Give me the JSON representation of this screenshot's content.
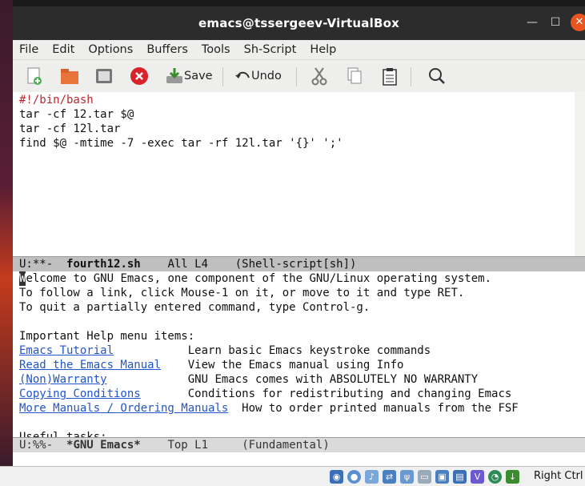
{
  "window": {
    "title": "emacs@tssergeev-VirtualBox"
  },
  "menu": [
    "File",
    "Edit",
    "Options",
    "Buffers",
    "Tools",
    "Sh-Script",
    "Help"
  ],
  "toolbar": {
    "save_label": "Save",
    "undo_label": "Undo"
  },
  "editor": {
    "lines": [
      "#!/bin/bash",
      "tar -cf 12.tar $@",
      "tar -cf 12l.tar",
      "find $@ -mtime -7 -exec tar -rf 12l.tar '{}' ';'"
    ],
    "modeline": {
      "status": "U:**-",
      "buffer": "fourth12.sh",
      "position": "All L4",
      "mode": "(Shell-script[sh])"
    }
  },
  "help": {
    "intro": [
      "elcome to GNU Emacs, one component of the GNU/Linux operating system.",
      "To follow a link, click Mouse-1 on it, or move to it and type RET.",
      "To quit a partially entered command, type Control-g."
    ],
    "cursor_char": "W",
    "heading": "Important Help menu items:",
    "items": [
      {
        "link": "Emacs Tutorial",
        "desc": "Learn basic Emacs keystroke commands"
      },
      {
        "link": "Read the Emacs Manual",
        "desc": "View the Emacs manual using Info"
      },
      {
        "link": "(Non)Warranty",
        "desc": "GNU Emacs comes with ABSOLUTELY NO WARRANTY"
      },
      {
        "link": "Copying Conditions",
        "desc": "Conditions for redistributing and changing Emacs"
      },
      {
        "link": "More Manuals / Ordering Manuals",
        "desc": "How to order printed manuals from the FSF"
      }
    ],
    "useful": "Useful tasks:",
    "modeline": {
      "status": "U:%%-",
      "buffer": "*GNU Emacs*",
      "position": "Top L1",
      "mode": "(Fundamental)"
    }
  },
  "taskbar": {
    "host_key": "Right Ctrl"
  }
}
